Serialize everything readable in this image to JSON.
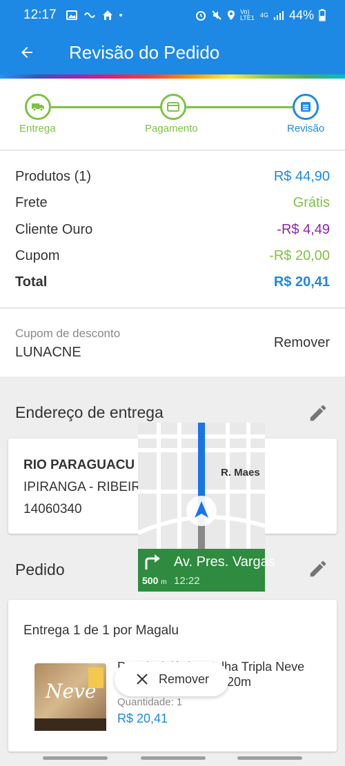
{
  "status_bar": {
    "time": "12:17",
    "network_label": "Vo) LTE1",
    "signal_label": "4G",
    "battery": "44%"
  },
  "app_bar": {
    "title": "Revisão do Pedido",
    "back_icon": "arrow-back-icon"
  },
  "steps": [
    {
      "label": "Entrega",
      "icon": "truck-icon",
      "state": "done"
    },
    {
      "label": "Pagamento",
      "icon": "card-icon",
      "state": "done"
    },
    {
      "label": "Revisão",
      "icon": "list-icon",
      "state": "active"
    }
  ],
  "summary": {
    "rows": [
      {
        "label": "Produtos (1)",
        "value": "R$ 44,90",
        "color": "#1e88e5"
      },
      {
        "label": "Frete",
        "value": "Grátis",
        "color": "#7cc242"
      },
      {
        "label": "Cliente Ouro",
        "value": "-R$ 4,49",
        "color": "#8e24aa"
      },
      {
        "label": "Cupom",
        "value": "-R$ 20,00",
        "color": "#7cc242"
      }
    ],
    "total": {
      "label": "Total",
      "value": "R$ 20,41",
      "color": "#1e88e5"
    }
  },
  "coupon": {
    "label": "Cupom de desconto",
    "code": "LUNACNE",
    "remove": "Remover"
  },
  "address": {
    "section_title": "Endereço de entrega",
    "line1": "RIO PARAGUACU",
    "line2": "IPIRANGA - RIBEIR",
    "line3": "14060340"
  },
  "navigation_overlay": {
    "street_label": "R. Maes",
    "instruction": "Av. Pres. Vargas",
    "distance": "500",
    "distance_unit": "m",
    "eta": "12:22"
  },
  "order": {
    "section_title": "Pedido",
    "delivery": "Entrega 1 de 1 por Magalu",
    "product_name": "Papel Higiênico Folha Tripla Neve",
    "product_name_line2": "- 20m",
    "quantity": "Quantidade:  1",
    "price": "R$ 20,41",
    "product_brand": "Neve"
  },
  "toast": {
    "label": "Remover",
    "icon": "close-icon"
  },
  "colors": {
    "primary": "#1e88e5",
    "success": "#7cc242",
    "purple": "#8e24aa",
    "nav_green": "#2e8b3f"
  }
}
